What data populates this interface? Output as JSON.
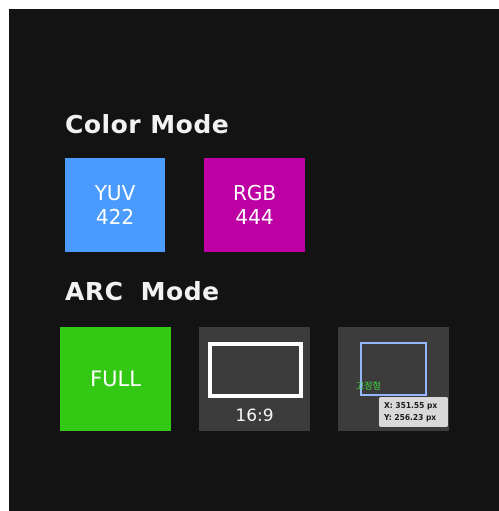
{
  "color_mode": {
    "heading": "Color Mode",
    "options": [
      {
        "line1": "YUV",
        "line2": "422",
        "color": "#4b9bff"
      },
      {
        "line1": "RGB",
        "line2": "444",
        "color": "#bd00a3"
      }
    ]
  },
  "arc_mode": {
    "heading": "ARC  Mode",
    "options": [
      {
        "label": "FULL",
        "color": "#33c813"
      },
      {
        "label": "16:9",
        "color": "#3c3c3c"
      },
      {
        "label": "고정형",
        "color": "#3c3c3c"
      }
    ]
  },
  "tooltip": {
    "x": "X: 351.55 px",
    "y": "Y: 256.23 px"
  },
  "colors": {
    "background": "#131313",
    "frame_outline": "#ffffff",
    "custom_outline": "#93b8ff",
    "tooltip_bg": "#d9d9d9"
  }
}
